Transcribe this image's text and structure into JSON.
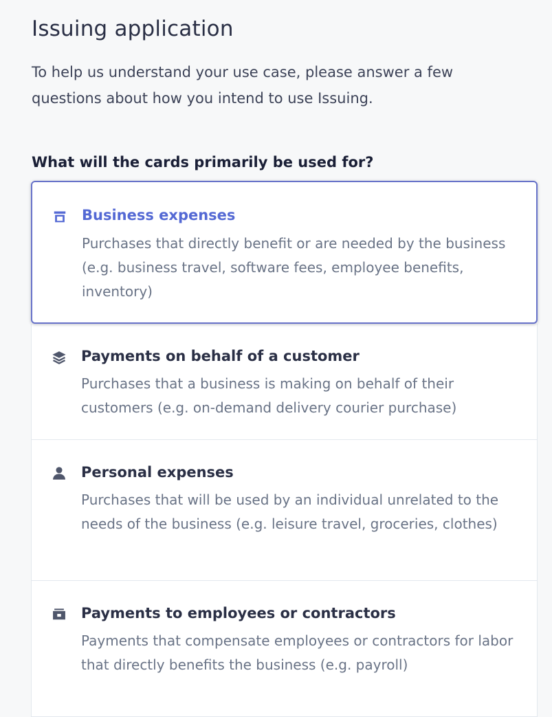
{
  "page": {
    "title": "Issuing application",
    "intro": "To help us understand your use case, please answer a few questions about how you intend to use Issuing.",
    "question": "What will the cards primarily be used for?"
  },
  "options": [
    {
      "icon": "storefront-icon",
      "title": "Business expenses",
      "description": "Purchases that directly benefit or are needed by the business (e.g. business travel, software fees, employee benefits, inventory)",
      "selected": true
    },
    {
      "icon": "layers-icon",
      "title": "Payments on behalf of a customer",
      "description": "Purchases that a business is making on behalf of their customers (e.g. on-demand delivery courier purchase)",
      "selected": false
    },
    {
      "icon": "person-icon",
      "title": "Personal expenses",
      "description": "Purchases that will be used by an individual unrelated to the needs of the business (e.g. leisure travel, groceries, clothes)",
      "selected": false
    },
    {
      "icon": "cash-register-icon",
      "title": "Payments to employees or contractors",
      "description": "Payments that compensate employees or contractors for labor that directly benefits the business (e.g. payroll)",
      "selected": false
    }
  ],
  "colors": {
    "accent": "#5469d4",
    "selected_border": "#6772c9",
    "title_text": "#2a2f45",
    "description_text": "#697386",
    "page_background": "#f7f8f9"
  }
}
